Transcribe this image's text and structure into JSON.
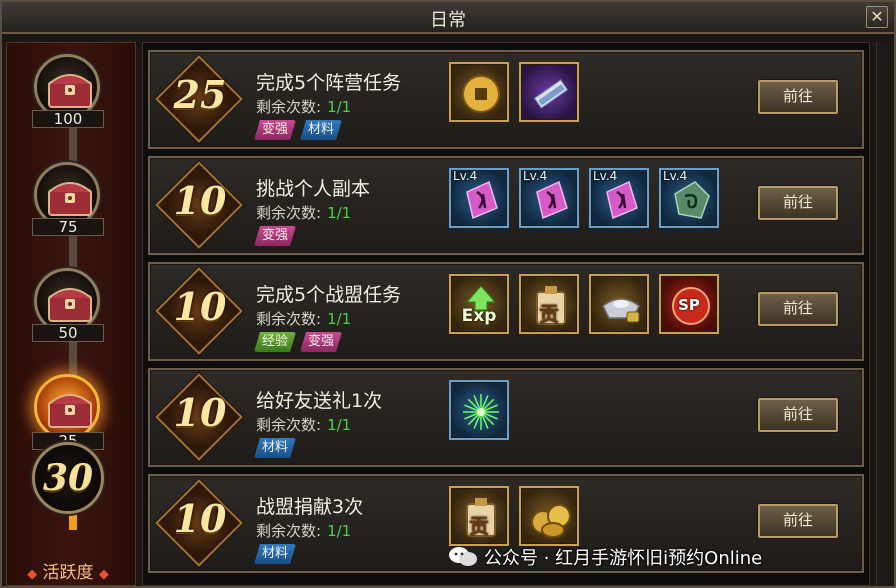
{
  "window": {
    "title": "日常",
    "close_glyph": "✕"
  },
  "sidebar": {
    "milestones": [
      {
        "label": "100",
        "active": false
      },
      {
        "label": "75",
        "active": false
      },
      {
        "label": "50",
        "active": false
      },
      {
        "label": "25",
        "active": true
      }
    ],
    "progress_fraction": 0.3,
    "current_score": "30",
    "activity_label": "活跃度",
    "activity_dot": "◆"
  },
  "tasks": [
    {
      "points": "25",
      "name": "完成5个阵营任务",
      "remain_label": "剩余次数:",
      "remain_value": "1/1",
      "tags": [
        {
          "text": "变强",
          "color": "pink"
        },
        {
          "text": "材料",
          "color": "blue"
        }
      ],
      "rewards": [
        {
          "icon": "gold-coin-icon",
          "quality": "gold"
        },
        {
          "icon": "scroll-icon",
          "quality": "purple"
        }
      ],
      "button": "前往"
    },
    {
      "points": "10",
      "name": "挑战个人副本",
      "remain_label": "剩余次数:",
      "remain_value": "1/1",
      "tags": [
        {
          "text": "变强",
          "color": "pink"
        }
      ],
      "rewards": [
        {
          "icon": "rune-stone-icon",
          "quality": "blue",
          "level": "Lv.4"
        },
        {
          "icon": "rune-stone-icon",
          "quality": "blue",
          "level": "Lv.4"
        },
        {
          "icon": "rune-stone-icon",
          "quality": "blue",
          "level": "Lv.4"
        },
        {
          "icon": "green-rune-stone-icon",
          "quality": "blue",
          "level": "Lv.4"
        }
      ],
      "button": "前往"
    },
    {
      "points": "10",
      "name": "完成5个战盟任务",
      "remain_label": "剩余次数:",
      "remain_value": "1/1",
      "tags": [
        {
          "text": "经验",
          "color": "green"
        },
        {
          "text": "变强",
          "color": "pink"
        }
      ],
      "rewards": [
        {
          "icon": "exp-icon",
          "quality": "gold",
          "text": "Exp"
        },
        {
          "icon": "contribution-bag-icon",
          "quality": "gold",
          "text": "贡"
        },
        {
          "icon": "silver-ingot-locked-icon",
          "quality": "gold"
        },
        {
          "icon": "sp-orb-icon",
          "quality": "red",
          "text": "SP"
        }
      ],
      "button": "前往"
    },
    {
      "points": "10",
      "name": "给好友送礼1次",
      "remain_label": "剩余次数:",
      "remain_value": "1/1",
      "tags": [
        {
          "text": "材料",
          "color": "blue"
        }
      ],
      "rewards": [
        {
          "icon": "firework-icon",
          "quality": "blue"
        }
      ],
      "button": "前往"
    },
    {
      "points": "10",
      "name": "战盟捐献3次",
      "remain_label": "剩余次数:",
      "remain_value": "1/1",
      "tags": [
        {
          "text": "材料",
          "color": "blue"
        }
      ],
      "rewards": [
        {
          "icon": "contribution-bag-icon",
          "quality": "gold",
          "text": "贡"
        },
        {
          "icon": "coin-pile-icon",
          "quality": "gold"
        }
      ],
      "button": "前往"
    }
  ],
  "watermark": {
    "text": "公众号 · 红月手游怀旧i预约Online"
  }
}
